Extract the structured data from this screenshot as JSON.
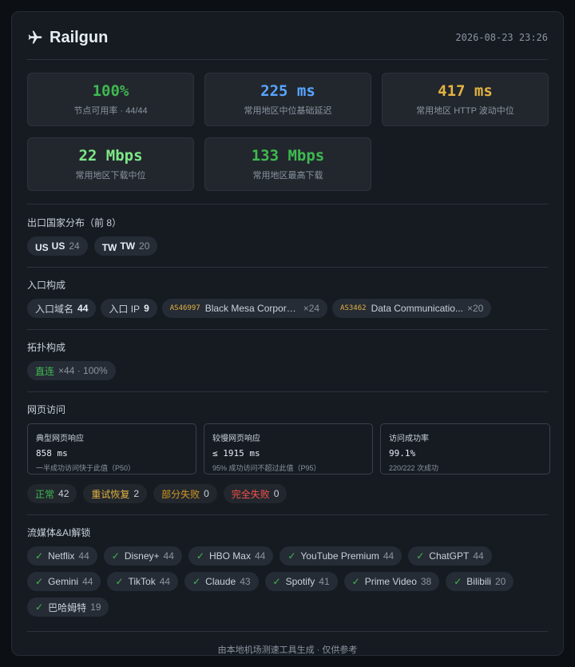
{
  "header": {
    "title": "Railgun",
    "timestamp": "2026-08-23 23:26"
  },
  "stats": [
    {
      "value": "100%",
      "label": "节点可用率 · 44/44",
      "color": "#3fb950"
    },
    {
      "value": "225 ms",
      "label": "常用地区中位基础延迟",
      "color": "#58a6ff"
    },
    {
      "value": "417 ms",
      "label": "常用地区 HTTP 波动中位",
      "color": "#e3b341"
    },
    {
      "value": "22 Mbps",
      "label": "常用地区下载中位",
      "color": "#7ee787"
    },
    {
      "value": "133 Mbps",
      "label": "常用地区最高下载",
      "color": "#3fb950"
    }
  ],
  "exit": {
    "title": "出口国家分布（前 8）",
    "items": [
      {
        "flag": "US",
        "code": "US",
        "count": "24"
      },
      {
        "flag": "TW",
        "code": "TW",
        "count": "20"
      }
    ]
  },
  "entry": {
    "title": "入口构成",
    "domain_label": "入口域名",
    "domain_count": "44",
    "ip_label": "入口 IP",
    "ip_count": "9",
    "asns": [
      {
        "asn": "AS46997",
        "name": "Black Mesa Corporat...",
        "count": "×24"
      },
      {
        "asn": "AS3462",
        "name": "Data Communicatio...",
        "count": "×20"
      }
    ]
  },
  "topology": {
    "title": "拓扑构成",
    "label": "直连",
    "detail": "×44 · 100%"
  },
  "web": {
    "title": "网页访问",
    "boxes": [
      {
        "label": "典型网页响应",
        "value": "858 ms",
        "sub": "一半成功访问快于此值（P50）"
      },
      {
        "label": "较慢网页响应",
        "value": "≤ 1915 ms",
        "sub": "95% 成功访问不超过此值（P95）"
      },
      {
        "label": "访问成功率",
        "value": "99.1%",
        "sub": "220/222 次成功"
      }
    ],
    "statuses": [
      {
        "label": "正常",
        "count": "42"
      },
      {
        "label": "重试恢复",
        "count": "2"
      },
      {
        "label": "部分失败",
        "count": "0"
      },
      {
        "label": "完全失败",
        "count": "0"
      }
    ]
  },
  "media": {
    "title": "流媒体&AI解锁",
    "items": [
      {
        "name": "Netflix",
        "count": "44"
      },
      {
        "name": "Disney+",
        "count": "44"
      },
      {
        "name": "HBO Max",
        "count": "44"
      },
      {
        "name": "YouTube Premium",
        "count": "44"
      },
      {
        "name": "ChatGPT",
        "count": "44"
      },
      {
        "name": "Gemini",
        "count": "44"
      },
      {
        "name": "TikTok",
        "count": "44"
      },
      {
        "name": "Claude",
        "count": "43"
      },
      {
        "name": "Spotify",
        "count": "41"
      },
      {
        "name": "Prime Video",
        "count": "38"
      },
      {
        "name": "Bilibili",
        "count": "20"
      },
      {
        "name": "巴哈姆特",
        "count": "19"
      }
    ]
  },
  "footer": "由本地机场测速工具生成 · 仅供参考"
}
